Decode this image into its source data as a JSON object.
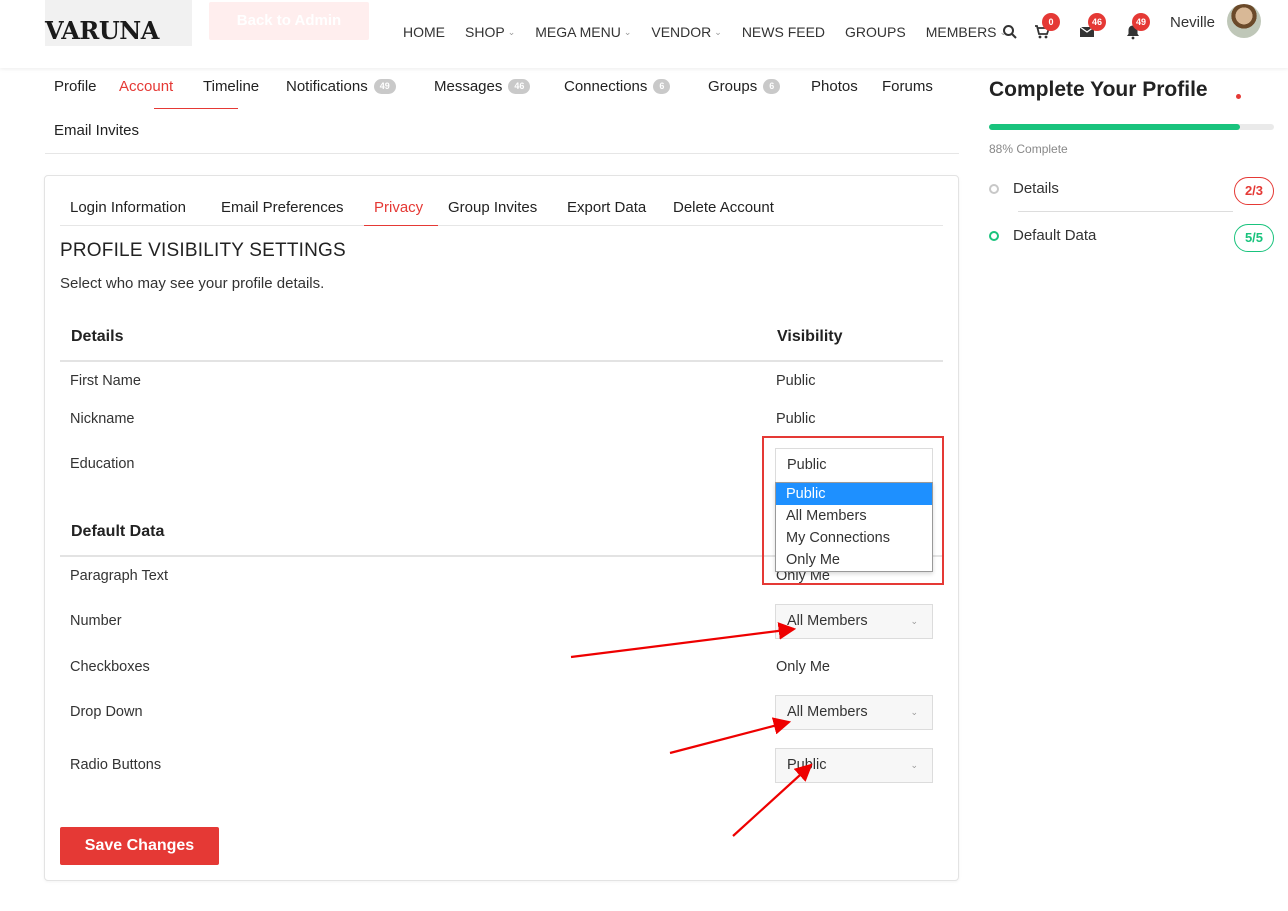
{
  "header": {
    "logo": "VARUNA",
    "back_to_admin": "Back to Admin",
    "nav": [
      {
        "label": "HOME",
        "dropdown": false
      },
      {
        "label": "SHOP",
        "dropdown": true
      },
      {
        "label": "MEGA MENU",
        "dropdown": true
      },
      {
        "label": "VENDOR",
        "dropdown": true
      },
      {
        "label": "NEWS FEED",
        "dropdown": false
      },
      {
        "label": "GROUPS",
        "dropdown": false
      },
      {
        "label": "MEMBERS",
        "dropdown": true
      }
    ],
    "chevron": "⌄",
    "cart_count": "0",
    "messages_count": "46",
    "notifications_count": "49",
    "user_name": "Neville"
  },
  "profile_tabs": [
    {
      "label": "Profile",
      "count": ""
    },
    {
      "label": "Account",
      "count": "",
      "active": true
    },
    {
      "label": "Timeline",
      "count": ""
    },
    {
      "label": "Notifications",
      "count": "49"
    },
    {
      "label": "Messages",
      "count": "46"
    },
    {
      "label": "Connections",
      "count": "6"
    },
    {
      "label": "Groups",
      "count": "6"
    },
    {
      "label": "Photos",
      "count": ""
    },
    {
      "label": "Forums",
      "count": ""
    },
    {
      "label": "Email Invites",
      "count": ""
    }
  ],
  "settings_tabs": [
    "Login Information",
    "Email Preferences",
    "Privacy",
    "Group Invites",
    "Export Data",
    "Delete Account"
  ],
  "active_settings_tab": "Privacy",
  "section": {
    "title": "PROFILE VISIBILITY SETTINGS",
    "subtitle": "Select who may see your profile details."
  },
  "groups": {
    "details": {
      "header": "Details",
      "visibility_header": "Visibility",
      "rows": [
        {
          "label": "First Name",
          "value": "Public"
        },
        {
          "label": "Nickname",
          "value": "Public"
        },
        {
          "label": "Education",
          "value": "Public"
        }
      ]
    },
    "default_data": {
      "header": "Default Data",
      "rows": [
        {
          "label": "Paragraph Text",
          "value": "Only Me"
        },
        {
          "label": "Number",
          "value": "All Members"
        },
        {
          "label": "Checkboxes",
          "value": "Only Me"
        },
        {
          "label": "Drop Down",
          "value": "All Members"
        },
        {
          "label": "Radio Buttons",
          "value": "Public"
        }
      ]
    }
  },
  "visibility_options": [
    "Public",
    "All Members",
    "My Connections",
    "Only Me"
  ],
  "save_button": "Save Changes",
  "sidebar": {
    "title": "Complete Your Profile",
    "progress_fraction": 0.88,
    "progress_text": "88% Complete",
    "items": [
      {
        "label": "Details",
        "badge": "2/3",
        "status": "incomplete"
      },
      {
        "label": "Default Data",
        "badge": "5/5",
        "status": "complete"
      }
    ]
  },
  "colors": {
    "accent": "#e53935",
    "success": "#19c37d",
    "option_highlight": "#1e90ff"
  }
}
